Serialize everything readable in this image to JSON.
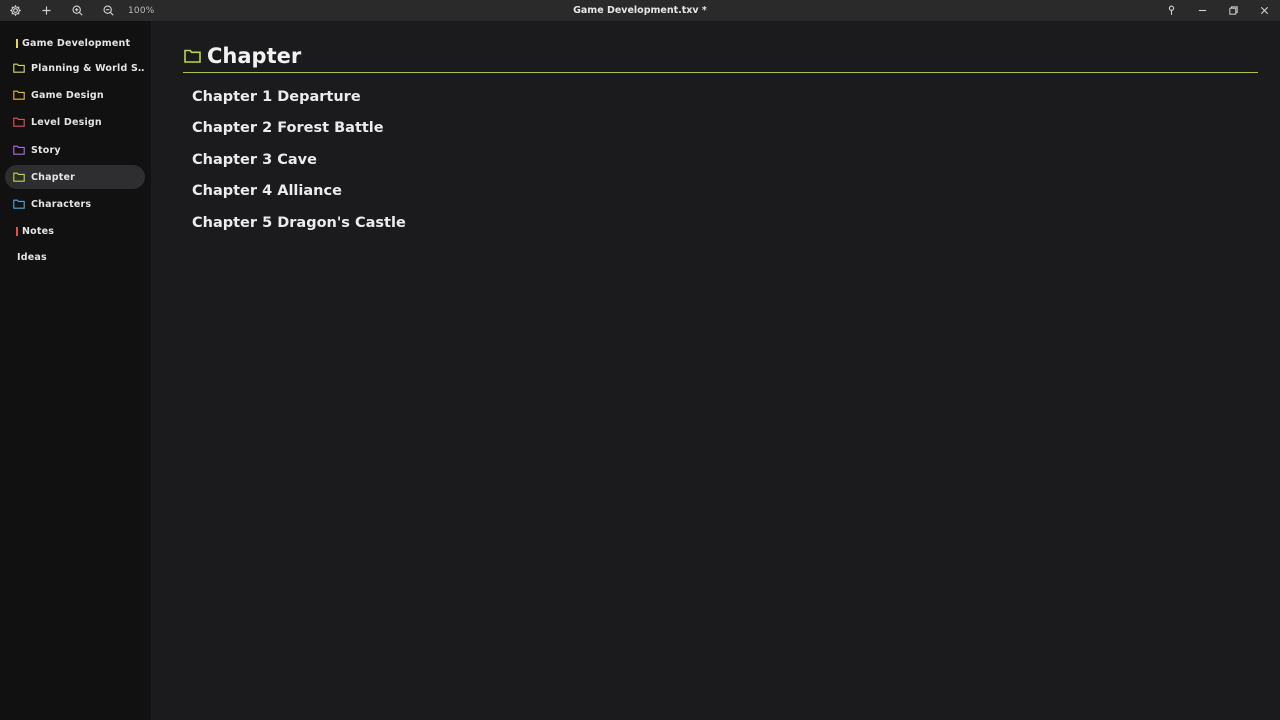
{
  "window": {
    "title": "Game Development.txv *",
    "zoom": "100%"
  },
  "sidebar": {
    "items": [
      {
        "label": "Game Development",
        "kind": "bar",
        "color": "#e8d84a"
      },
      {
        "label": "Planning & World S…",
        "kind": "folder",
        "color": "#d8d86a"
      },
      {
        "label": "Game Design",
        "kind": "folder",
        "color": "#e8b84a"
      },
      {
        "label": "Level Design",
        "kind": "folder",
        "color": "#e85050"
      },
      {
        "label": "Story",
        "kind": "folder",
        "color": "#b06ae0"
      },
      {
        "label": "Chapter",
        "kind": "folder",
        "color": "#b8d84a",
        "active": true
      },
      {
        "label": "Characters",
        "kind": "folder",
        "color": "#4aa8e8"
      },
      {
        "label": "Notes",
        "kind": "bar",
        "color": "#e85050"
      },
      {
        "label": "Ideas",
        "kind": "none",
        "color": ""
      }
    ]
  },
  "main": {
    "heading": "Chapter",
    "accent": "#b8d84a",
    "chapters": [
      "Chapter 1 Departure",
      "Chapter 2 Forest Battle",
      "Chapter 3 Cave",
      "Chapter 4 Alliance",
      "Chapter 5 Dragon's Castle"
    ]
  }
}
